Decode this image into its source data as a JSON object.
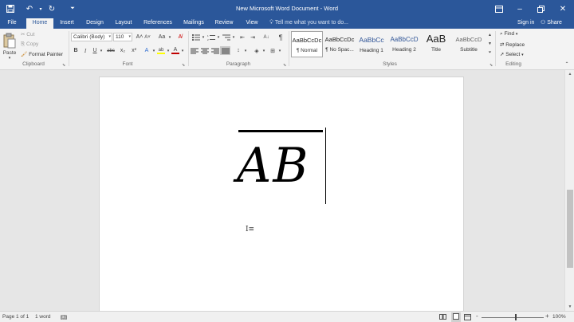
{
  "title_bar": {
    "title": "New Microsoft Word Document - Word",
    "save_icon": "save-icon",
    "undo_icon": "undo-icon",
    "redo_icon": "redo-icon",
    "customize_icon": "customize-qat-icon"
  },
  "tabs": [
    "File",
    "Home",
    "Insert",
    "Design",
    "Layout",
    "References",
    "Mailings",
    "Review",
    "View"
  ],
  "active_tab": "Home",
  "tell_me": "Tell me what you want to do...",
  "sign_in": "Sign in",
  "share": "Share",
  "clipboard": {
    "paste": "Paste",
    "cut": "Cut",
    "copy": "Copy",
    "format_painter": "Format Painter",
    "label": "Clipboard"
  },
  "font": {
    "name": "Calibri (Body)",
    "size": "110",
    "bold": "B",
    "italic": "I",
    "underline": "U",
    "strikethrough": "abc",
    "subscript": "x₂",
    "superscript": "x²",
    "grow": "A˄",
    "shrink": "A˅",
    "change_case": "Aa",
    "font_color": "A",
    "highlight": "ab",
    "label": "Font"
  },
  "paragraph": {
    "label": "Paragraph"
  },
  "styles": {
    "items": [
      {
        "preview": "AaBbCcDc",
        "name": "¶ Normal"
      },
      {
        "preview": "AaBbCcDc",
        "name": "¶ No Spac..."
      },
      {
        "preview": "AaBbCc",
        "name": "Heading 1"
      },
      {
        "preview": "AaBbCcD",
        "name": "Heading 2"
      },
      {
        "preview": "AaB",
        "name": "Title"
      },
      {
        "preview": "AaBbCcD",
        "name": "Subtitle"
      }
    ],
    "label": "Styles"
  },
  "editing": {
    "find": "Find",
    "replace": "Replace",
    "select": "Select",
    "label": "Editing"
  },
  "document": {
    "equation": "AB"
  },
  "status": {
    "page": "Page 1 of 1",
    "words": "1 word",
    "zoom": "100%",
    "zoom_minus": "-",
    "zoom_plus": "+"
  },
  "colors": {
    "brand": "#2b579a",
    "ribbon": "#f3f3f3",
    "font_color_accent": "#c00000",
    "highlight_accent": "#ffff00"
  }
}
